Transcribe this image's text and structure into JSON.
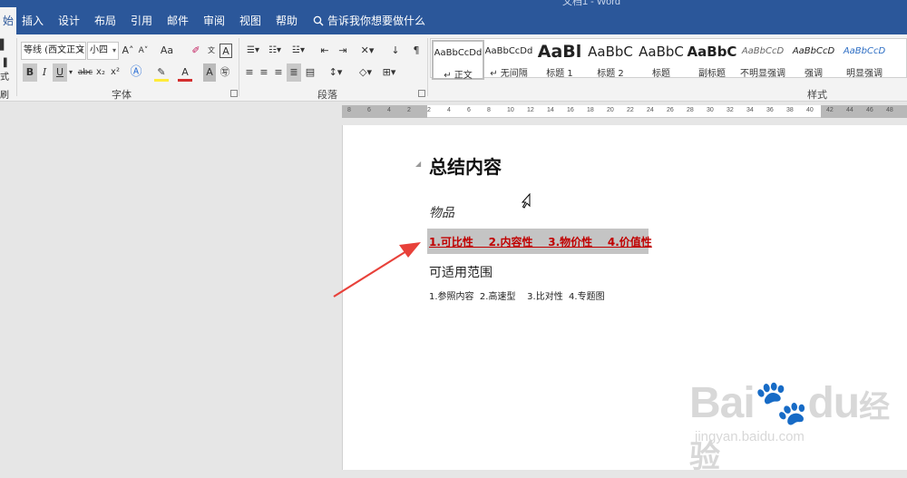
{
  "window": {
    "title": "文档1 - Word"
  },
  "tabs": [
    {
      "label": "开始",
      "display": "始"
    },
    {
      "label": "插入"
    },
    {
      "label": "设计"
    },
    {
      "label": "布局"
    },
    {
      "label": "引用"
    },
    {
      "label": "邮件"
    },
    {
      "label": "审阅"
    },
    {
      "label": "视图"
    },
    {
      "label": "帮助"
    }
  ],
  "tell_me": "告诉我你想要做什么",
  "clipboard": {
    "brush_label": "式刷"
  },
  "font_group": {
    "label": "字体",
    "font_name": "等线 (西文正文)",
    "font_size": "小四",
    "grow_label": "A˄",
    "shrink_label": "A˅",
    "case_label": "Aa",
    "bold": "B",
    "italic": "I",
    "underline": "U",
    "strike": "abc",
    "subscript": "x₂",
    "superscript": "x²"
  },
  "paragraph_group": {
    "label": "段落"
  },
  "styles_group": {
    "label": "样式",
    "items": [
      {
        "preview": "AaBbCcDd",
        "name": "↵ 正文"
      },
      {
        "preview": "AaBbCcDd",
        "name": "↵ 无间隔"
      },
      {
        "preview": "AaBl",
        "name": "标题 1"
      },
      {
        "preview": "AaBbC",
        "name": "标题 2"
      },
      {
        "preview": "AaBbC",
        "name": "标题"
      },
      {
        "preview": "AaBbC",
        "name": "副标题"
      },
      {
        "preview": "AaBbCcD",
        "name": "不明显强调"
      },
      {
        "preview": "AaBbCcD",
        "name": "强调"
      },
      {
        "preview": "AaBbCcD",
        "name": "明显强调"
      }
    ]
  },
  "ruler": {
    "ticks": [
      "8",
      "6",
      "4",
      "2",
      "2",
      "4",
      "6",
      "8",
      "10",
      "12",
      "14",
      "16",
      "18",
      "20",
      "22",
      "24",
      "26",
      "28",
      "30",
      "32",
      "34",
      "36",
      "38",
      "40",
      "42",
      "44",
      "46",
      "48"
    ]
  },
  "document": {
    "heading": "总结内容",
    "item_label": "物品",
    "highlight_line": "1.可比性    2.内容性    3.物价性    4.价值性",
    "scope_label": "可适用范围",
    "scope_items": "1.参照内容  2.高速型    3.比对性  4.专题图"
  },
  "watermark": {
    "brand": "Bai",
    "brand_tail": "du",
    "cn": "经验",
    "url": "jingyan.baidu.com"
  },
  "colors": {
    "ribbon_blue": "#2b579a",
    "highlight_text": "#c00000",
    "annotation_arrow": "#e8413a"
  }
}
